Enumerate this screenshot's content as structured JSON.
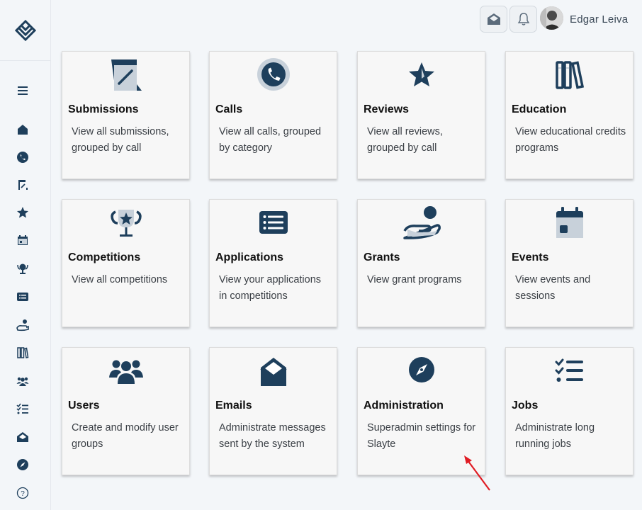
{
  "user": {
    "name": "Edgar Leiva"
  },
  "colors": {
    "icon": "#1e3f5c",
    "accent_arrow": "#e01c24"
  },
  "sidebar": {
    "items": [
      {
        "icon": "menu-icon"
      },
      {
        "icon": "home-icon"
      },
      {
        "icon": "phone-icon"
      },
      {
        "icon": "submissions-icon"
      },
      {
        "icon": "star-icon"
      },
      {
        "icon": "calendar-icon"
      },
      {
        "icon": "trophy-icon"
      },
      {
        "icon": "list-icon"
      },
      {
        "icon": "hand-icon"
      },
      {
        "icon": "books-icon"
      },
      {
        "icon": "users-icon"
      },
      {
        "icon": "checklist-icon"
      },
      {
        "icon": "envelope-icon"
      },
      {
        "icon": "compass-icon"
      },
      {
        "icon": "help-icon"
      }
    ]
  },
  "cards": [
    {
      "title": "Submissions",
      "desc": "View all submissions, grouped by call",
      "icon": "submissions-icon"
    },
    {
      "title": "Calls",
      "desc": "View all calls, grouped by category",
      "icon": "phone-icon"
    },
    {
      "title": "Reviews",
      "desc": "View all reviews, grouped by call",
      "icon": "star-icon"
    },
    {
      "title": "Education",
      "desc": "View educational credits programs",
      "icon": "books-icon"
    },
    {
      "title": "Competitions",
      "desc": "View all competitions",
      "icon": "trophy-icon"
    },
    {
      "title": "Applications",
      "desc": "View your applications in competitions",
      "icon": "list-icon"
    },
    {
      "title": "Grants",
      "desc": "View grant programs",
      "icon": "hand-icon"
    },
    {
      "title": "Events",
      "desc": "View events and sessions",
      "icon": "calendar-icon"
    },
    {
      "title": "Users",
      "desc": "Create and modify user groups",
      "icon": "users-icon"
    },
    {
      "title": "Emails",
      "desc": "Administrate messages sent by the system",
      "icon": "envelope-icon"
    },
    {
      "title": "Administration",
      "desc": "Superadmin settings for Slayte",
      "icon": "compass-icon"
    },
    {
      "title": "Jobs",
      "desc": "Administrate long running jobs",
      "icon": "checklist-icon"
    }
  ]
}
